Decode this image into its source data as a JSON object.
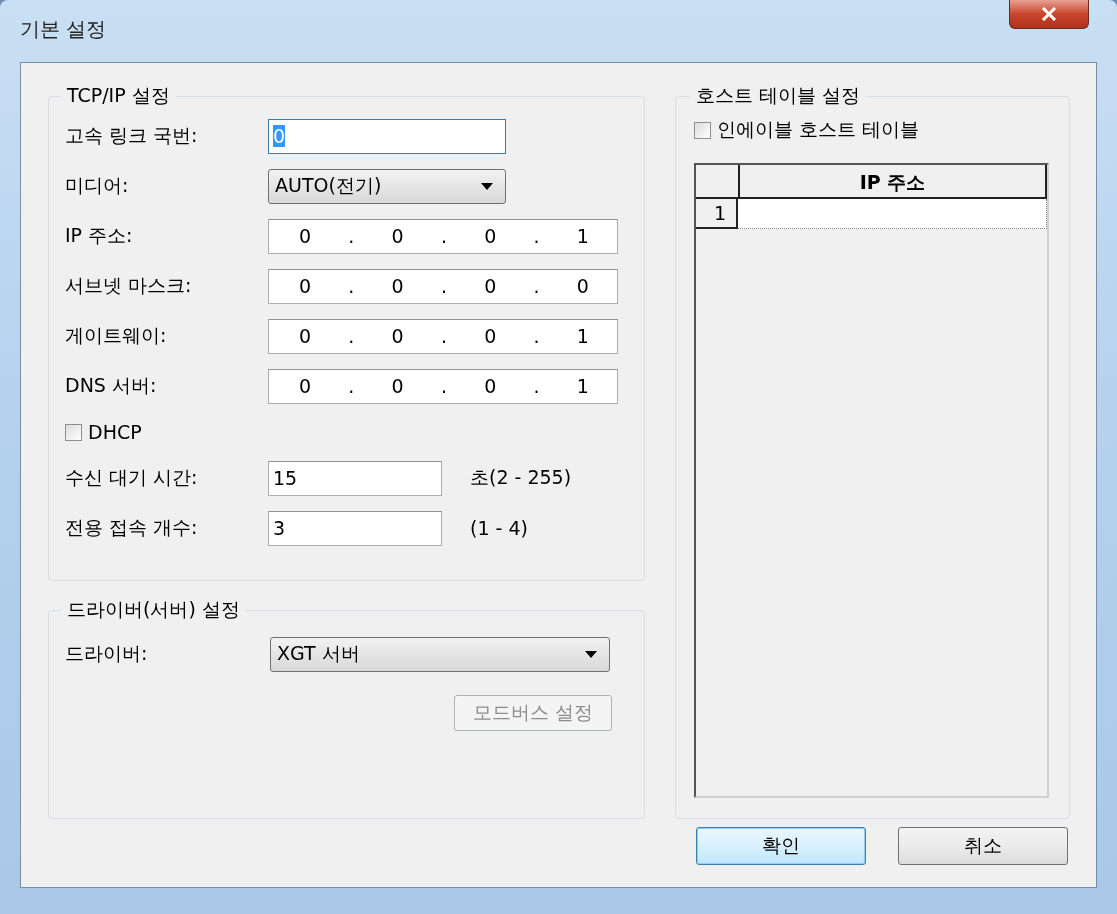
{
  "window": {
    "title": "기본 설정"
  },
  "tcpip": {
    "title": "TCP/IP 설정",
    "octet_separator": ".",
    "rows": [
      {
        "kind": "text",
        "label": "고속 링크 국번:",
        "value": "0",
        "focused": true
      },
      {
        "kind": "select",
        "label": "미디어:",
        "value": "AUTO(전기)"
      },
      {
        "kind": "ip",
        "label": "IP 주소:",
        "octets": [
          "0",
          "0",
          "0",
          "1"
        ]
      },
      {
        "kind": "ip",
        "label": "서브넷 마스크:",
        "octets": [
          "0",
          "0",
          "0",
          "0"
        ]
      },
      {
        "kind": "ip",
        "label": "게이트웨이:",
        "octets": [
          "0",
          "0",
          "0",
          "1"
        ]
      },
      {
        "kind": "ip",
        "label": "DNS 서버:",
        "octets": [
          "0",
          "0",
          "0",
          "1"
        ]
      },
      {
        "kind": "checkbox",
        "label": "DHCP",
        "checked": false
      },
      {
        "kind": "number",
        "label": "수신 대기 시간:",
        "value": "15",
        "range": "초(2 - 255)"
      },
      {
        "kind": "number",
        "label": "전용 접속 개수:",
        "value": "3",
        "range": "(1 - 4)"
      }
    ]
  },
  "driver": {
    "title": "드라이버(서버) 설정",
    "label": "드라이버:",
    "value": "XGT 서버",
    "button": {
      "label": "모드버스 설정",
      "disabled": true
    }
  },
  "host_table": {
    "title": "호스트 테이블 설정",
    "enable": {
      "label": "인에이블 호스트 테이블",
      "checked": false
    },
    "columns": [
      "IP 주소"
    ],
    "rows": [
      {
        "number": "1"
      }
    ]
  },
  "buttons": [
    {
      "label": "확인",
      "default": true
    },
    {
      "label": "취소",
      "default": false
    }
  ]
}
